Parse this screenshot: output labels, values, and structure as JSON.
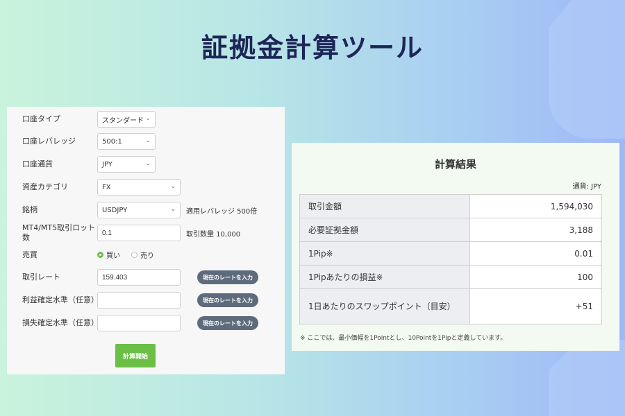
{
  "page_title": "証拠金計算ツール",
  "form": {
    "account_type": {
      "label": "口座タイプ",
      "value": "スタンダード"
    },
    "leverage": {
      "label": "口座レバレッジ",
      "value": "500:1"
    },
    "currency": {
      "label": "口座通貨",
      "value": "JPY"
    },
    "asset_category": {
      "label": "資産カテゴリ",
      "value": "FX"
    },
    "symbol": {
      "label": "銘柄",
      "value": "USDJPY",
      "note": "適用レバレッジ 500倍"
    },
    "lot": {
      "label": "MT4/MT5取引ロット数",
      "value": "0.1",
      "note": "取引数量 10,000"
    },
    "side": {
      "label": "売買",
      "buy": "買い",
      "sell": "売り",
      "selected": "buy"
    },
    "rate": {
      "label": "取引レート",
      "value": "159.403",
      "button": "現在のレートを入力"
    },
    "take_profit": {
      "label": "利益確定水準（任意）",
      "value": "",
      "button": "現在のレートを入力"
    },
    "stop_loss": {
      "label": "損失確定水準（任意）",
      "value": "",
      "button": "現在のレートを入力"
    },
    "submit": "計算開始"
  },
  "result": {
    "title": "計算結果",
    "currency_note": "通貨: JPY",
    "rows": [
      {
        "key": "取引金額",
        "value": "1,594,030"
      },
      {
        "key": "必要証拠金額",
        "value": "3,188"
      },
      {
        "key": "1Pip※",
        "value": "0.01"
      },
      {
        "key": "1Pipあたりの損益※",
        "value": "100"
      },
      {
        "key": "1日あたりのスワップポイント（目安）",
        "value": "+51"
      }
    ],
    "footnote": "※ ここでは、最小価幅を1Pointとし、10Pointを1Pipと定義しています。"
  },
  "colors": {
    "accent_green": "#6cbf45",
    "title_navy": "#1d2657",
    "rate_button": "#5e6b7c"
  }
}
